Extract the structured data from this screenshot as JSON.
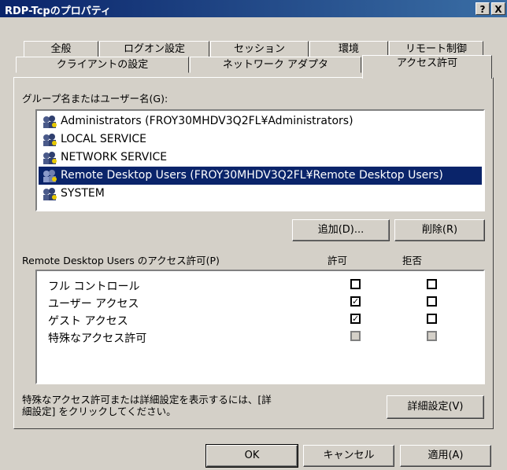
{
  "window": {
    "title": "RDP-Tcpのプロパティ",
    "help_btn": "?",
    "close_btn": "X"
  },
  "tabs_row1": [
    "全般",
    "ログオン設定",
    "セッション",
    "環境",
    "リモート制御"
  ],
  "tabs_row2": [
    "クライアントの設定",
    "ネットワーク アダプタ",
    "アクセス許可"
  ],
  "active_tab": "アクセス許可",
  "groups_label": "グループ名またはユーザー名(G):",
  "groups": [
    "Administrators (FROY30MHDV3Q2FL¥Administrators)",
    "LOCAL SERVICE",
    "NETWORK SERVICE",
    "Remote Desktop Users (FROY30MHDV3Q2FL¥Remote Desktop Users)",
    "SYSTEM"
  ],
  "selected_group": "Remote Desktop Users (FROY30MHDV3Q2FL¥Remote Desktop Users)",
  "add_button": "追加(D)...",
  "remove_button": "削除(R)",
  "permissions_label": "Remote Desktop Users のアクセス許可(P)",
  "allow_header": "許可",
  "deny_header": "拒否",
  "permissions": [
    {
      "name": "フル コントロール",
      "allow": false,
      "deny": false,
      "disabled": false
    },
    {
      "name": "ユーザー アクセス",
      "allow": true,
      "deny": false,
      "disabled": false
    },
    {
      "name": "ゲスト アクセス",
      "allow": true,
      "deny": false,
      "disabled": false
    },
    {
      "name": "特殊なアクセス許可",
      "allow": false,
      "deny": false,
      "disabled": true
    }
  ],
  "advanced_text_line1": "特殊なアクセス許可または詳細設定を表示するには、[詳",
  "advanced_text_line2": "細設定] をクリックしてください。",
  "advanced_button": "詳細設定(V)",
  "ok_button": "OK",
  "cancel_button": "キャンセル",
  "apply_button": "適用(A)"
}
